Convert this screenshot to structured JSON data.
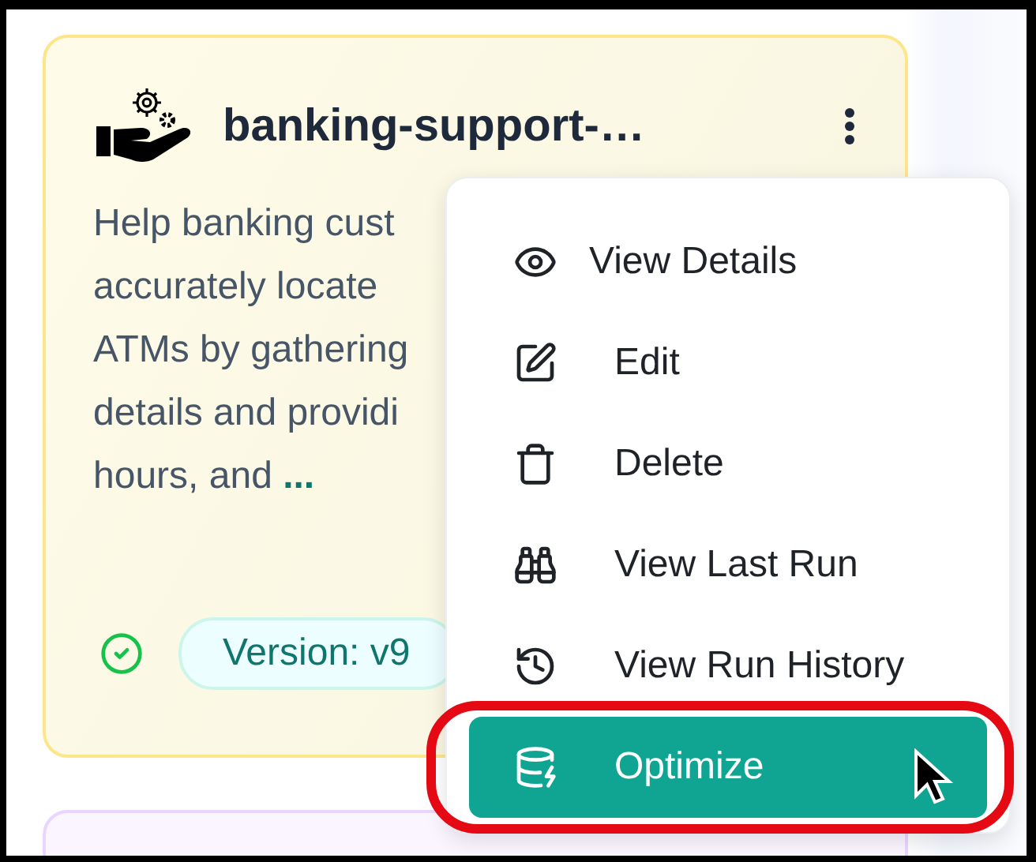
{
  "card": {
    "title": "banking-support-…",
    "description_lines": [
      "Help banking cust",
      "accurately locate",
      "ATMs by gathering",
      "details and providi",
      "hours, and"
    ],
    "more_link": "...",
    "status_ok": true,
    "version": "Version: v9"
  },
  "menu": {
    "items": [
      {
        "label": "View Details",
        "selected": false
      },
      {
        "label": "Edit",
        "selected": false
      },
      {
        "label": "Delete",
        "selected": false
      },
      {
        "label": "View Last Run",
        "selected": false
      },
      {
        "label": "View Run History",
        "selected": false
      },
      {
        "label": "Optimize",
        "selected": true
      }
    ]
  }
}
